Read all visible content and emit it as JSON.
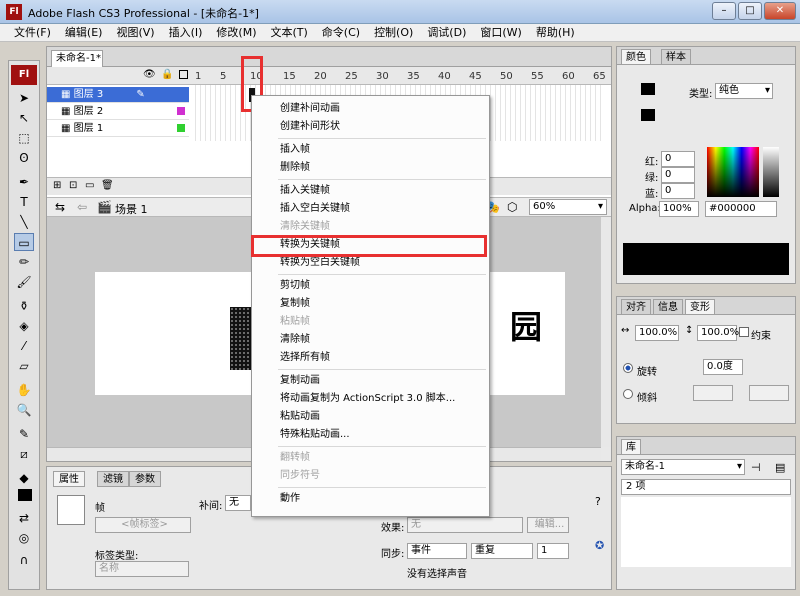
{
  "window": {
    "title": "Adobe Flash CS3 Professional - [未命名-1*]",
    "logo": "Fl",
    "min": "–",
    "max": "□",
    "close": "✕"
  },
  "menu": [
    "文件(F)",
    "编辑(E)",
    "视图(V)",
    "插入(I)",
    "修改(M)",
    "文本(T)",
    "命令(C)",
    "控制(O)",
    "调试(D)",
    "窗口(W)",
    "帮助(H)"
  ],
  "toolbox": {
    "logo": "Fl"
  },
  "document": {
    "tab": "未命名-1*"
  },
  "timeline": {
    "ticks": [
      "1",
      "5",
      "10",
      "15",
      "20",
      "25",
      "30",
      "35",
      "40",
      "45",
      "50",
      "55",
      "60",
      "65"
    ],
    "layers": [
      {
        "name": "图层 3",
        "selected": true
      },
      {
        "name": "图层 2",
        "selected": false
      },
      {
        "name": "图层 1",
        "selected": false
      }
    ]
  },
  "stage": {
    "scene": "场景 1",
    "zoom": "60%",
    "stage_text": "园"
  },
  "context_menu": {
    "items": [
      {
        "label": "创建补间动画",
        "disabled": false
      },
      {
        "label": "创建补间形状",
        "disabled": false
      },
      {
        "sep": true
      },
      {
        "label": "插入帧",
        "disabled": false
      },
      {
        "label": "删除帧",
        "disabled": false
      },
      {
        "sep": true
      },
      {
        "label": "插入关键帧",
        "disabled": false
      },
      {
        "label": "插入空白关键帧",
        "disabled": false
      },
      {
        "label": "清除关键帧",
        "disabled": true
      },
      {
        "label": "转换为关键帧",
        "disabled": false
      },
      {
        "label": "转换为空白关键帧",
        "disabled": false
      },
      {
        "sep": true
      },
      {
        "label": "剪切帧",
        "disabled": false
      },
      {
        "label": "复制帧",
        "disabled": false
      },
      {
        "label": "粘贴帧",
        "disabled": true
      },
      {
        "label": "清除帧",
        "disabled": false
      },
      {
        "label": "选择所有帧",
        "disabled": false
      },
      {
        "sep": true
      },
      {
        "label": "复制动画",
        "disabled": false
      },
      {
        "label": "将动画复制为 ActionScript 3.0 脚本...",
        "disabled": false
      },
      {
        "label": "粘贴动画",
        "disabled": false
      },
      {
        "label": "特殊粘贴动画...",
        "disabled": false
      },
      {
        "sep": true
      },
      {
        "label": "翻转帧",
        "disabled": true
      },
      {
        "label": "同步符号",
        "disabled": true
      },
      {
        "sep": true
      },
      {
        "label": "動作",
        "disabled": false
      }
    ]
  },
  "properties": {
    "tabs": [
      "属性",
      "滤镜",
      "参数"
    ],
    "frame_label": "帧",
    "frame_placeholder": "<帧标签>",
    "tween_label": "补间:",
    "tween_value": "无",
    "label_type": "标签类型:",
    "label_type_value": "名称",
    "effect_label": "效果:",
    "effect_value": "无",
    "edit_button": "编辑...",
    "sync_label": "同步:",
    "sync_event": "事件",
    "sync_repeat": "重复",
    "sync_count": "1",
    "no_sound": "没有选择声音"
  },
  "color_panel": {
    "tabs": [
      "颜色",
      "样本"
    ],
    "type_label": "类型:",
    "type_value": "纯色",
    "red": "红:",
    "green": "绿:",
    "blue": "蓝:",
    "red_value": "0",
    "green_value": "0",
    "blue_value": "0",
    "alpha_label": "Alpha:",
    "alpha_value": "100%",
    "hex": "#000000"
  },
  "transform_panel": {
    "tabs": [
      "对齐",
      "信息",
      "变形"
    ],
    "width": "100.0%",
    "height": "100.0%",
    "constrain": "约束",
    "rotate": "旋转",
    "rotate_value": "0.0度",
    "skew": "倾斜"
  },
  "library_panel": {
    "tabs": [
      "库"
    ],
    "doc": "未命名-1",
    "count": "2 项"
  }
}
